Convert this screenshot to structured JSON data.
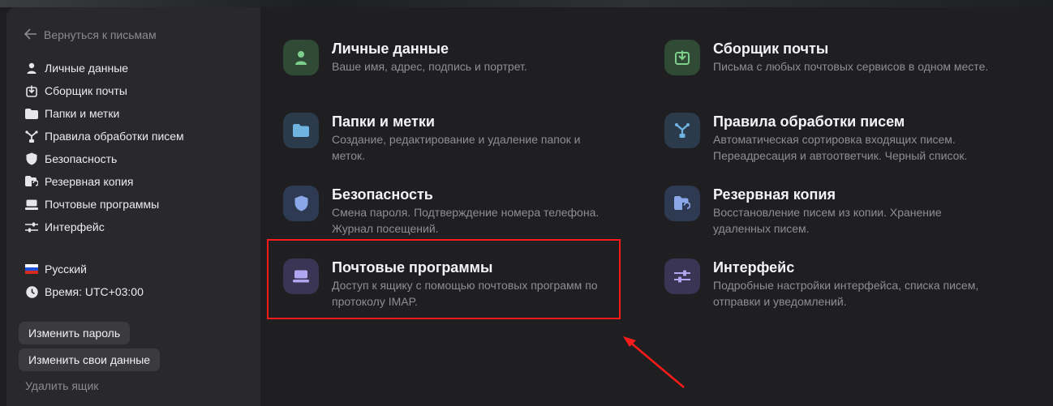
{
  "sidebar": {
    "back_label": "Вернуться к письмам",
    "items": [
      {
        "label": "Личные данные",
        "icon": "user-icon"
      },
      {
        "label": "Сборщик почты",
        "icon": "collector-icon"
      },
      {
        "label": "Папки и метки",
        "icon": "folder-icon"
      },
      {
        "label": "Правила обработки писем",
        "icon": "rules-icon"
      },
      {
        "label": "Безопасность",
        "icon": "shield-icon"
      },
      {
        "label": "Резервная копия",
        "icon": "backup-icon"
      },
      {
        "label": "Почтовые программы",
        "icon": "mail-client-icon"
      },
      {
        "label": "Интерфейс",
        "icon": "sliders-icon"
      }
    ],
    "language": "Русский",
    "time": "Время: UTC+03:00",
    "change_password": "Изменить пароль",
    "change_data": "Изменить свои данные",
    "delete_mailbox": "Удалить ящик"
  },
  "cards": [
    {
      "title": "Личные данные",
      "desc1": "Ваше имя, адрес, подпись и портрет.",
      "desc2": ""
    },
    {
      "title": "Сборщик почты",
      "desc1": "Письма с любых почтовых сервисов в одном месте.",
      "desc2": ""
    },
    {
      "title": "Папки и метки",
      "desc1": "Создание, редактирование и удаление папок и",
      "desc2": "меток."
    },
    {
      "title": "Правила обработки писем",
      "desc1": "Автоматическая сортировка входящих писем.",
      "desc2": "Переадресация и автоответчик. Черный список."
    },
    {
      "title": "Безопасность",
      "desc1": "Смена пароля. Подтверждение номера телефона.",
      "desc2": "Журнал посещений."
    },
    {
      "title": "Резервная копия",
      "desc1": "Восстановление писем из копии. Хранение",
      "desc2": "удаленных писем."
    },
    {
      "title": "Почтовые программы",
      "desc1": "Доступ к ящику с помощью почтовых программ по",
      "desc2": "протоколу IMAP."
    },
    {
      "title": "Интерфейс",
      "desc1": "Подробные настройки интерфейса, списка писем,",
      "desc2": "отправки и уведомлений."
    }
  ],
  "colors": {
    "highlight": "#ff1a1a",
    "green_tile": "#2f4a35",
    "blue_tile": "#2b3b4c",
    "purple_tile": "#3a3555"
  }
}
